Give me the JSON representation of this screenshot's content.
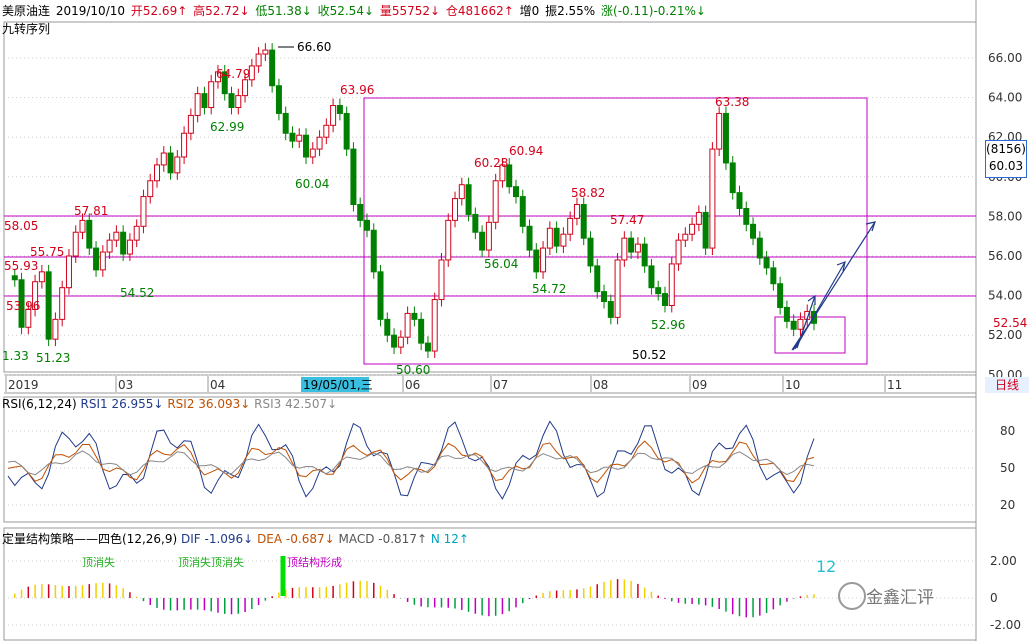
{
  "header": {
    "name": "美原油连",
    "date": "2019/10/10",
    "open": "开52.69↑",
    "high": "高52.72↓",
    "low": "低51.38↓",
    "close": "收52.54↓",
    "volume": "量55752↓",
    "oi": "仓481662↑",
    "inc": "增0",
    "amp": "振2.55%",
    "chg": "涨(-0.11)-0.21%↓"
  },
  "subtitle": "九转序列",
  "price_axis": [
    "66.00",
    "64.00",
    "62.00",
    "60.00",
    "58.00",
    "56.00",
    "54.00",
    "52.00",
    "50.00"
  ],
  "price_labels": {
    "high": "66.60",
    "p6396": "63.96",
    "p6338": "63.38",
    "p6094": "60.94",
    "p6028": "60.28",
    "p5882": "58.82",
    "p5747": "57.47",
    "p5805": "58.05",
    "p5781": "57.81",
    "p5575": "55.75",
    "p5593": "55.93",
    "p5396": "53.96",
    "p6479": "64.79",
    "p6299": "62.99",
    "p6004": "60.04",
    "p5604": "56.04",
    "p5472": "54.72",
    "p5296": "52.96",
    "p5452": "54.52",
    "p5123": "51.23",
    "p133": "1.33",
    "p5060": "50.60",
    "p5052": "50.52"
  },
  "badge": {
    "code": "(8156)",
    "price": "60.03"
  },
  "current_price": "52.54",
  "date_axis": {
    "labels": [
      "2019",
      "03",
      "04",
      "06",
      "07",
      "08",
      "09",
      "10",
      "11"
    ],
    "cursor": "19/05/01,三",
    "period": "日线"
  },
  "rsi": {
    "title": "RSI(6,12,24)",
    "rsi1": "RSI1 26.955↓",
    "rsi2": "RSI2 36.093↓",
    "rsi3": "RSI3 42.507↓",
    "axis": [
      "80",
      "50",
      "20"
    ]
  },
  "macd": {
    "title": "定量结构策略——四色(12,26,9)",
    "dif": "DIF -1.096↓",
    "dea": "DEA -0.687↓",
    "macd": "MACD -0.817↑",
    "n": "N 12↑",
    "axis": [
      "2.00",
      "0",
      "-2.00"
    ],
    "big_num": "12",
    "tags": [
      "顶消失",
      "顶消失顶消失",
      "顶结构形成"
    ]
  },
  "watermark": "金鑫汇评",
  "colors": {
    "up": "#d0021b",
    "down": "#008000",
    "level": "#c000c0"
  }
}
